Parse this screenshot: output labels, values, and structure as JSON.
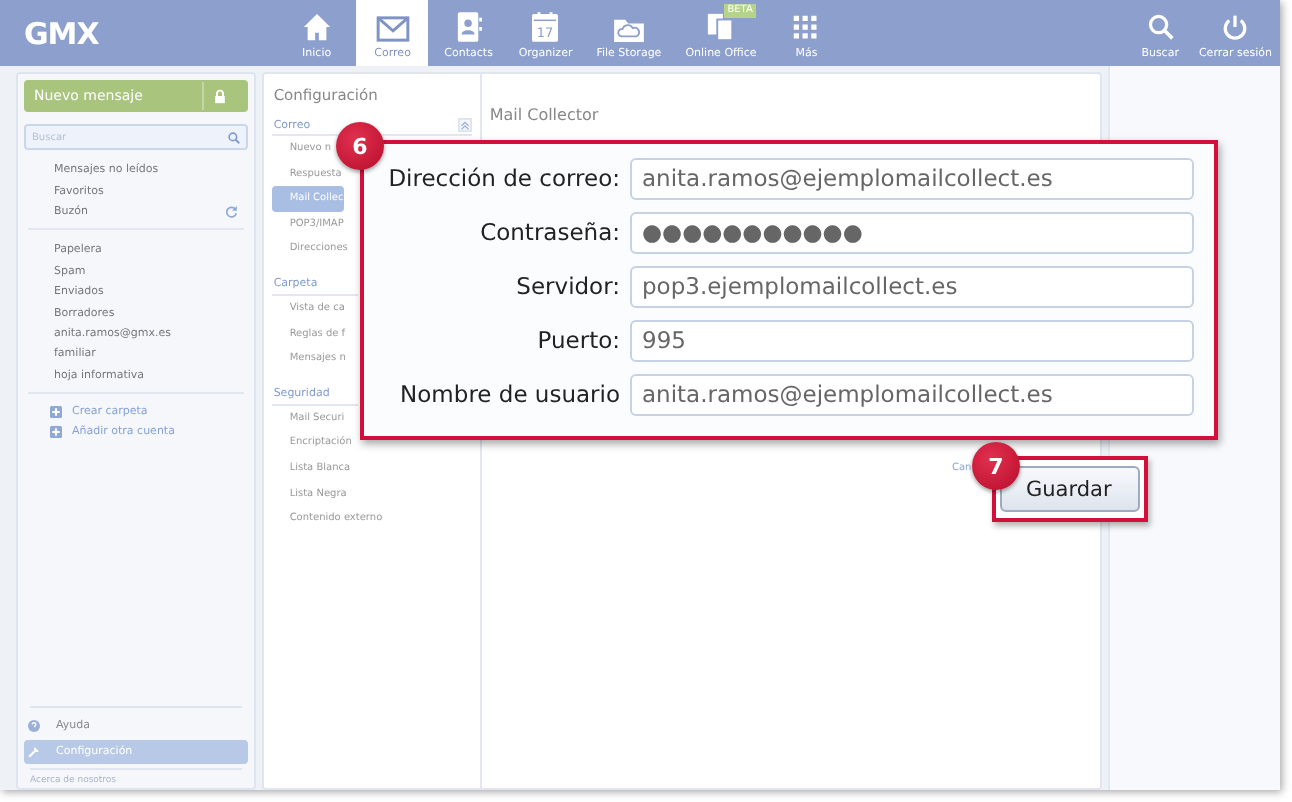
{
  "nav": {
    "logo": "GMX",
    "tabs": [
      {
        "label": "Inicio",
        "selected": false
      },
      {
        "label": "Correo",
        "selected": true
      },
      {
        "label": "Contacts",
        "selected": false
      },
      {
        "label": "Organizer",
        "selected": false,
        "icon_text": "17"
      },
      {
        "label": "File Storage",
        "selected": false
      },
      {
        "label": "Online Office",
        "selected": false,
        "badge": "BETA"
      },
      {
        "label": "Más",
        "selected": false
      }
    ],
    "actions": [
      {
        "label": "Buscar"
      },
      {
        "label": "Cerrar sesión"
      }
    ]
  },
  "sidebar": {
    "new_message": "Nuevo mensaje",
    "search": {
      "placeholder": "Buscar"
    },
    "folder_groups": [
      {
        "items": [
          {
            "label": "Mensajes no leídos"
          },
          {
            "label": "Favoritos"
          },
          {
            "label": "Buzón"
          }
        ]
      },
      {
        "items": [
          {
            "label": "Papelera"
          },
          {
            "label": "Spam"
          },
          {
            "label": "Enviados"
          },
          {
            "label": "Borradores"
          },
          {
            "label": "anita.ramos@gmx.es"
          },
          {
            "label": "familiar"
          },
          {
            "label": "hoja informativa"
          }
        ]
      }
    ],
    "actions": [
      {
        "label": "Crear carpeta"
      },
      {
        "label": "Añadir otra cuenta"
      }
    ],
    "footer": [
      {
        "label": "Ayuda",
        "selected": false
      },
      {
        "label": "Configuración",
        "selected": true
      }
    ],
    "about": "Acerca de nosotros"
  },
  "settings_menu": {
    "title": "Configuración",
    "sections": [
      {
        "title": "Correo",
        "items": [
          {
            "label": "Nuevo n",
            "selected": false
          },
          {
            "label": "Respuesta",
            "selected": false
          },
          {
            "label": "Mail Collec",
            "selected": true
          },
          {
            "label": "POP3/IMAP",
            "selected": false
          },
          {
            "label": "Direcciones",
            "selected": false
          }
        ]
      },
      {
        "title": "Carpeta",
        "items": [
          {
            "label": "Vista de ca",
            "selected": false
          },
          {
            "label": "Reglas de f",
            "selected": false
          },
          {
            "label": "Mensajes n",
            "selected": false
          }
        ]
      },
      {
        "title": "Seguridad",
        "items": [
          {
            "label": "Mail Securi",
            "selected": false
          },
          {
            "label": "Encriptación",
            "selected": false
          },
          {
            "label": "Lista Blanca",
            "selected": false
          },
          {
            "label": "Lista Negra",
            "selected": false
          },
          {
            "label": "Contenido externo",
            "selected": false
          }
        ]
      }
    ]
  },
  "content": {
    "title": "Mail Collector",
    "cancel": "Can",
    "save": "Guardar"
  },
  "form": {
    "step": "6",
    "fields": [
      {
        "label": "Dirección de correo:",
        "value": "anita.ramos@ejemplomailcollect.es"
      },
      {
        "label": "Contraseña:",
        "value": "●●●●●●●●●●●"
      },
      {
        "label": "Servidor:",
        "value": "pop3.ejemplomailcollect.es"
      },
      {
        "label": "Puerto:",
        "value": "995"
      },
      {
        "label": "Nombre de usuario",
        "value": "anita.ramos@ejemplomailcollect.es"
      }
    ]
  },
  "save_step": "7"
}
